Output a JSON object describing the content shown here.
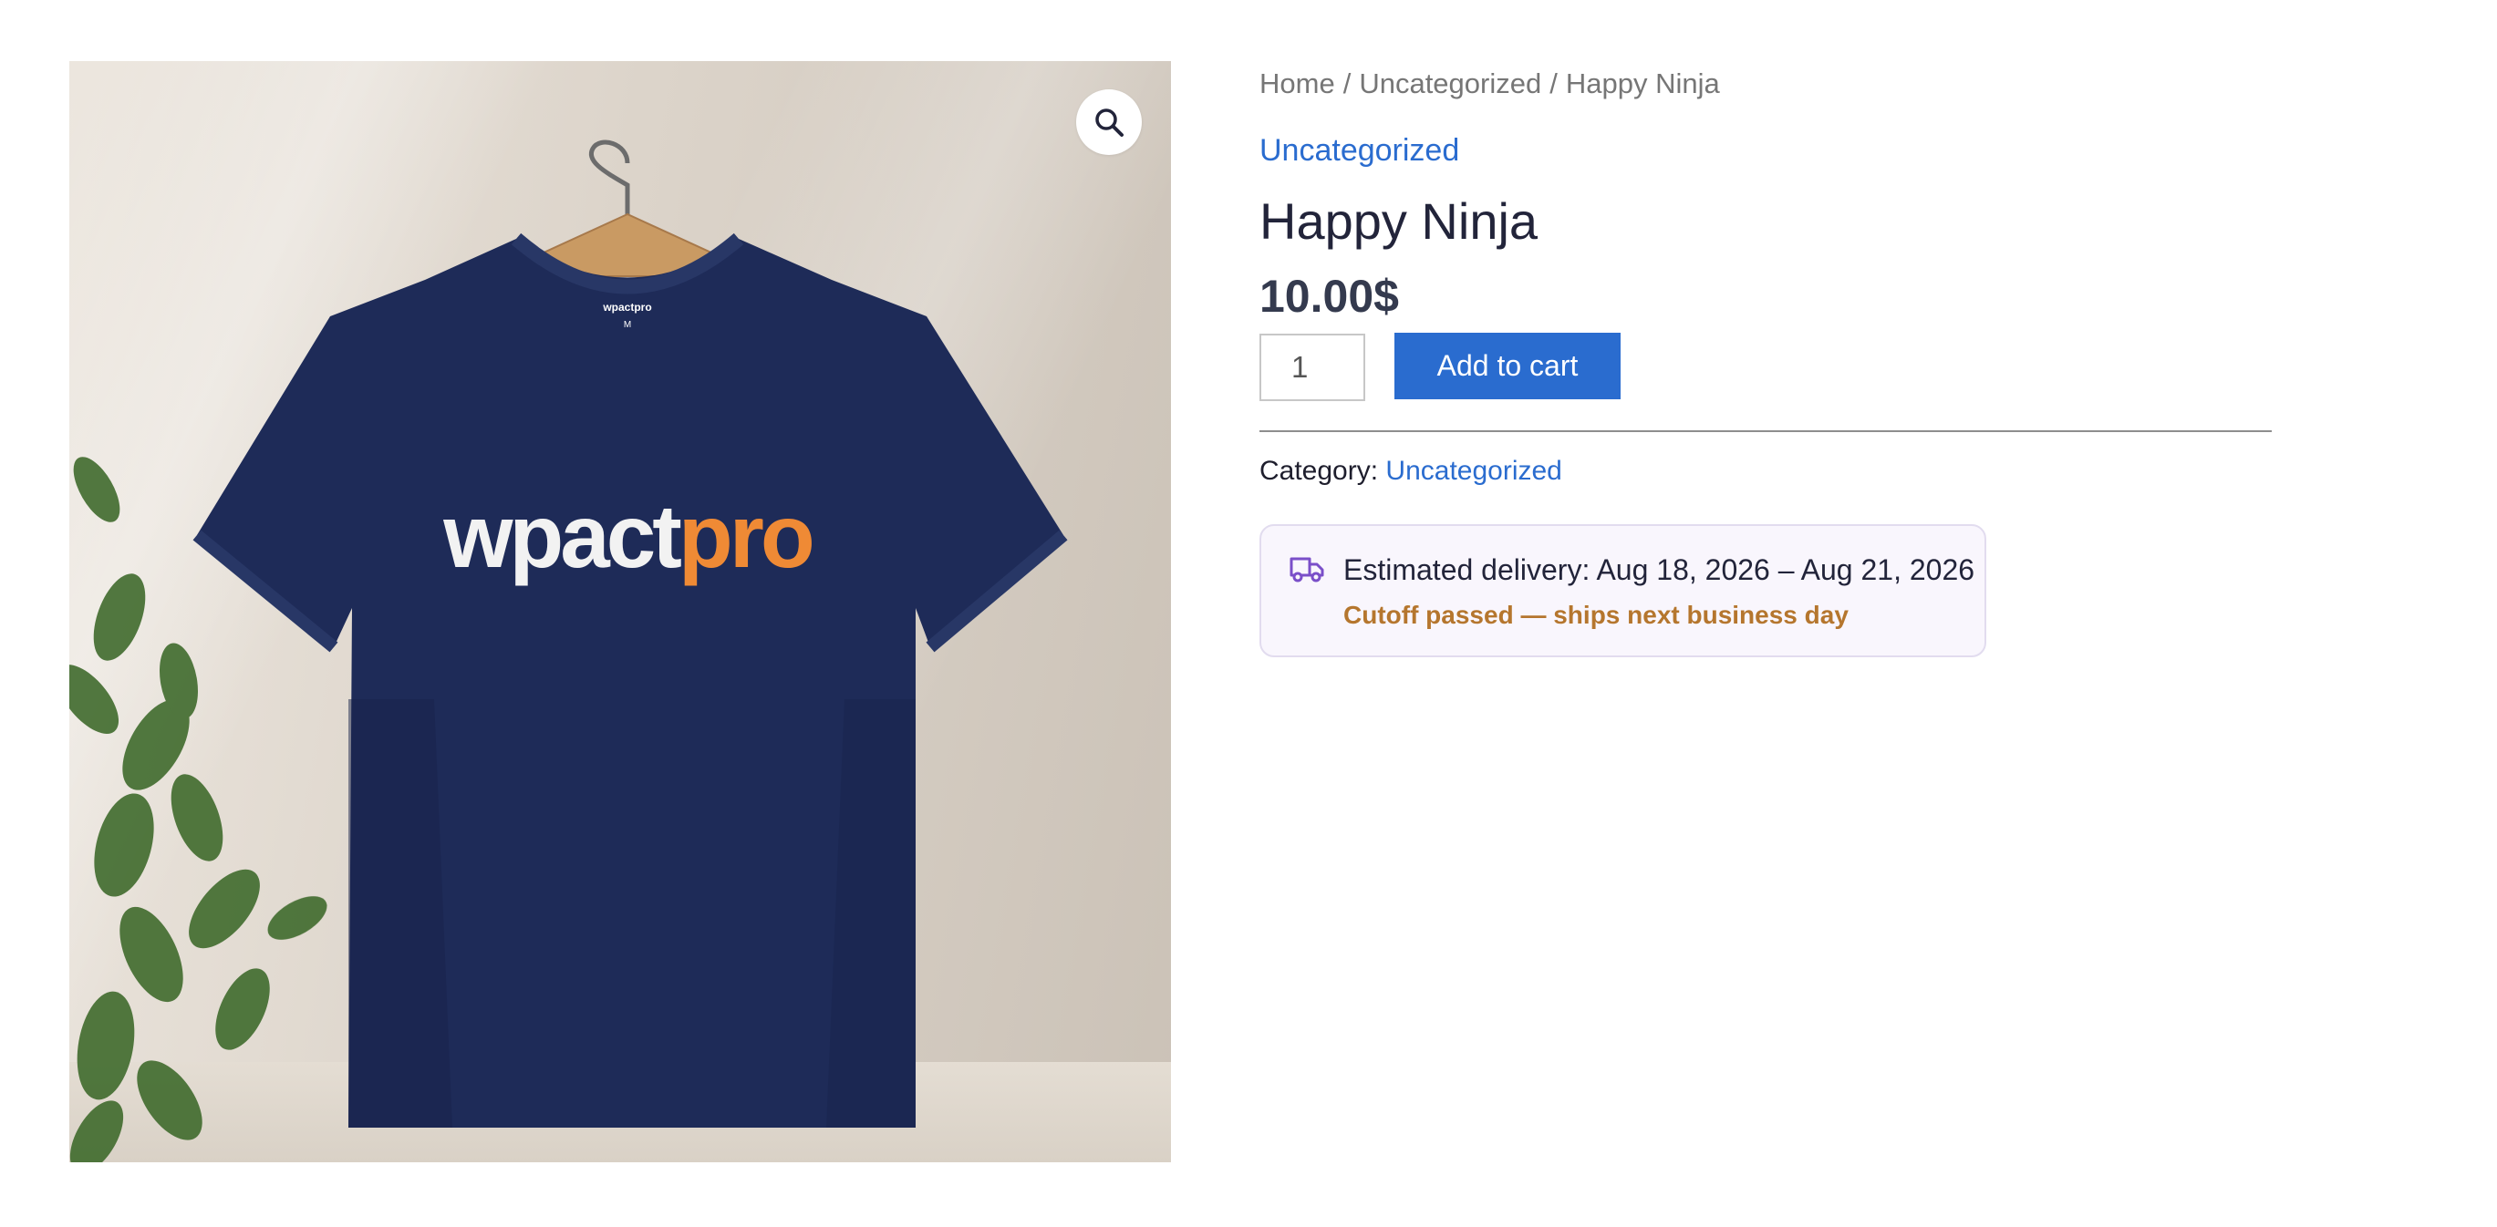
{
  "product_image": {
    "alt": "Happy Ninja",
    "shirt_print": {
      "left": "wpact",
      "right": "pro"
    },
    "label_brand": "wpactpro",
    "label_size": "M",
    "zoom_icon": "magnifier-icon"
  },
  "breadcrumb": {
    "items": [
      "Home",
      "Uncategorized",
      "Happy Ninja"
    ],
    "separator": "/"
  },
  "category_link": "Uncategorized",
  "product": {
    "title": "Happy Ninja",
    "price": "10.00$",
    "quantity": "1",
    "add_to_cart_label": "Add to cart"
  },
  "meta": {
    "category_label": "Category:",
    "category_value": "Uncategorized"
  },
  "delivery": {
    "icon": "truck-icon",
    "estimate": "Estimated delivery: Aug 18, 2026 – Aug 21, 2026",
    "cutoff": "Cutoff passed — ships next business day"
  },
  "colors": {
    "accent": "#2a6ccf",
    "cutoff_text": "#b5762e",
    "shirt": "#1e2b58",
    "print_orange": "#ef8a35",
    "delivery_bg": "#f9f6fd",
    "truck_icon": "#7a4fc9"
  }
}
